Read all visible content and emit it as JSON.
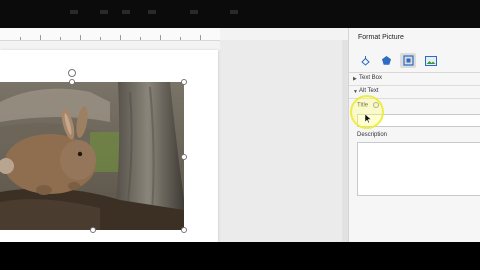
{
  "panel": {
    "title": "Format Picture",
    "tabs": [
      {
        "icon": "fill-line-icon"
      },
      {
        "icon": "effects-pentagon-icon"
      },
      {
        "icon": "layout-properties-icon"
      },
      {
        "icon": "picture-icon"
      }
    ],
    "sections": {
      "text_box": "Text Box",
      "alt_text": "Alt Text"
    },
    "alt_text": {
      "title_label": "Title",
      "title_value": "",
      "description_label": "Description",
      "description_value": ""
    }
  },
  "document": {
    "image": "rabbit-by-tree-photo"
  }
}
